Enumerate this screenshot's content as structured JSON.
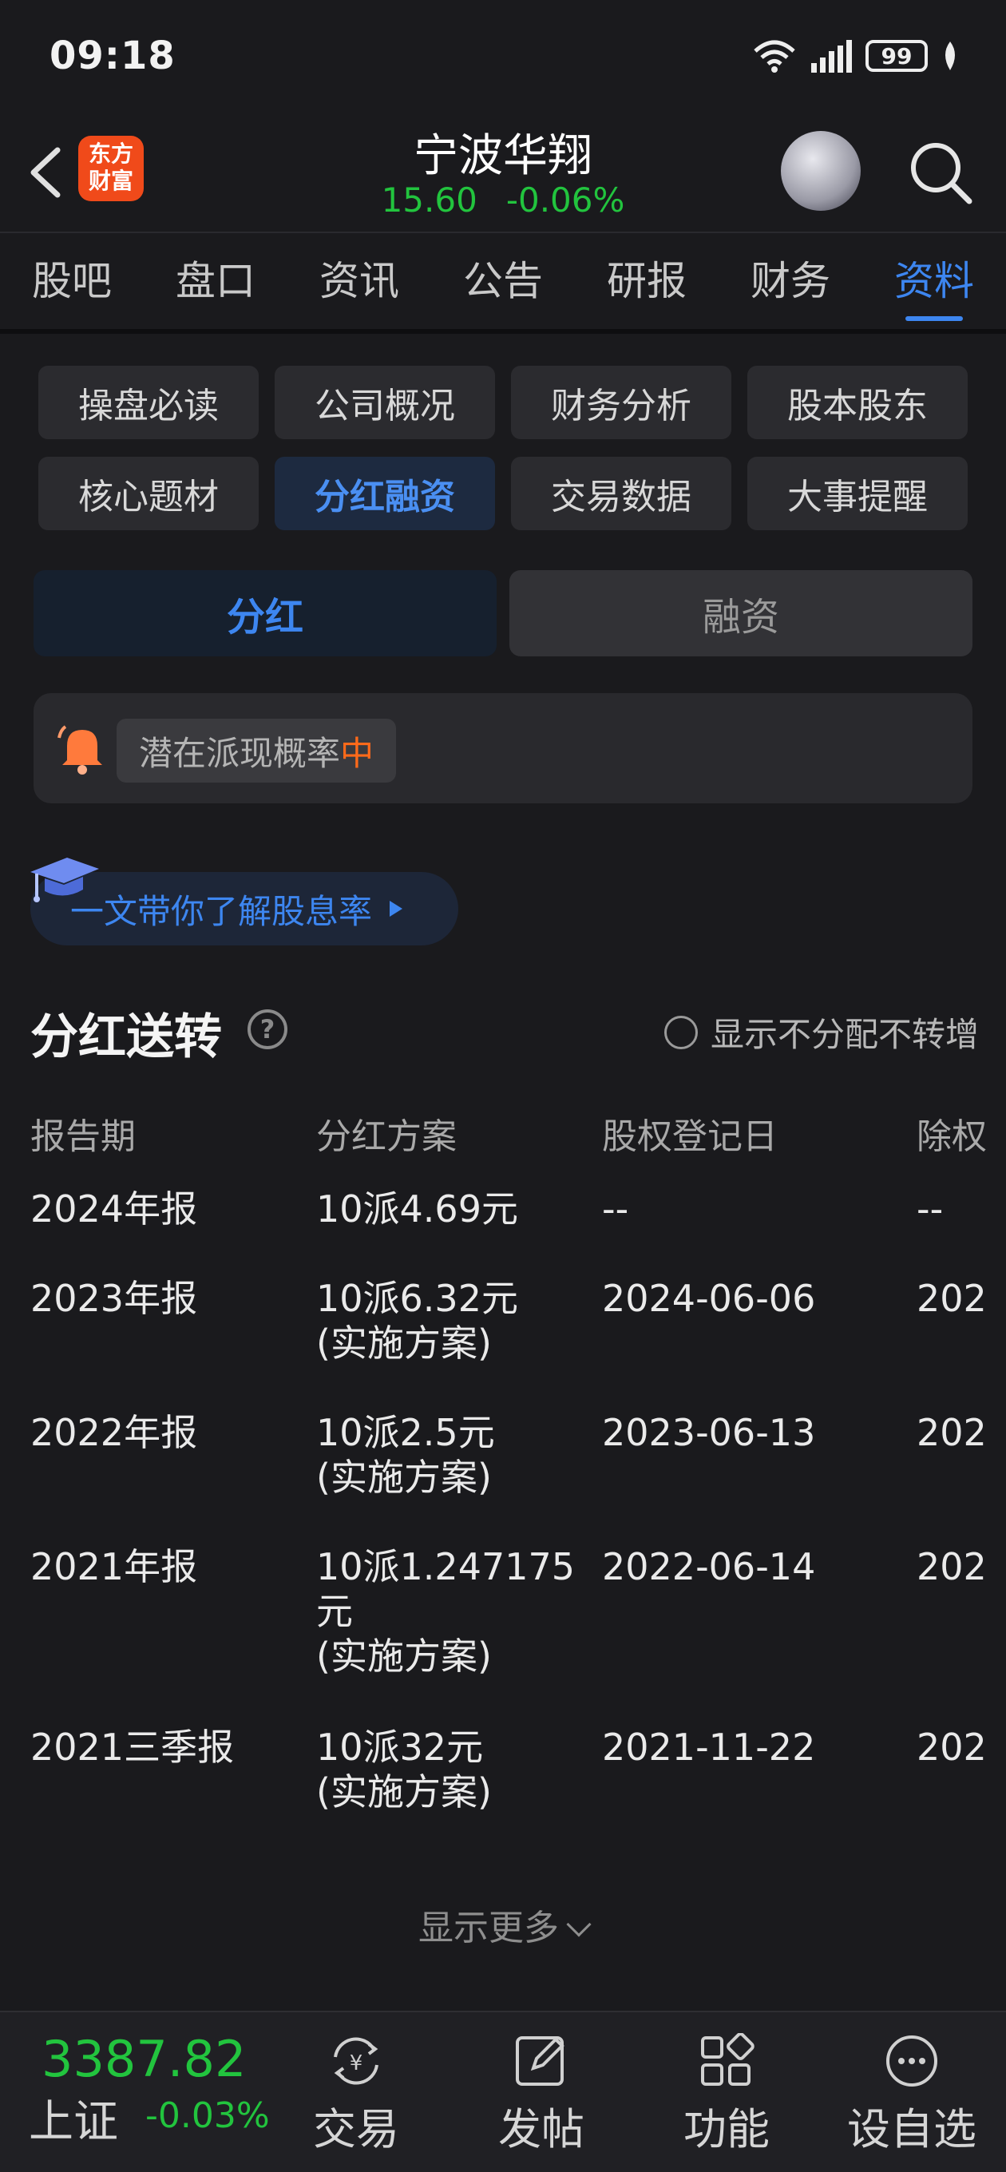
{
  "status": {
    "time": "09:18",
    "battery": "99"
  },
  "header": {
    "logo_line1": "东方",
    "logo_line2": "财富",
    "stock_name": "宁波华翔",
    "price": "15.60",
    "change": "-0.06%"
  },
  "tabs": [
    "股吧",
    "盘口",
    "资讯",
    "公告",
    "研报",
    "财务",
    "资料"
  ],
  "active_tab": "资料",
  "chips": [
    "操盘必读",
    "公司概况",
    "财务分析",
    "股本股东",
    "核心题材",
    "分红融资",
    "交易数据",
    "大事提醒"
  ],
  "active_chip": "分红融资",
  "segments": {
    "dividend": "分红",
    "financing": "融资"
  },
  "alert": {
    "label": "潜在派现概率",
    "level": "中"
  },
  "promo": {
    "text": "一文带你了解股息率"
  },
  "section": {
    "title": "分红送转",
    "help": "?",
    "toggle_label": "显示不分配不转增"
  },
  "table": {
    "headers": [
      "报告期",
      "分红方案",
      "股权登记日",
      "除权"
    ],
    "rows": [
      {
        "period": "2024年报",
        "plan": "10派4.69元",
        "plan_note": "",
        "record_date": "--",
        "ex_date": "--"
      },
      {
        "period": "2023年报",
        "plan": "10派6.32元",
        "plan_note": "(实施方案)",
        "record_date": "2024-06-06",
        "ex_date": "202"
      },
      {
        "period": "2022年报",
        "plan": "10派2.5元",
        "plan_note": "(实施方案)",
        "record_date": "2023-06-13",
        "ex_date": "202"
      },
      {
        "period": "2021年报",
        "plan": "10派1.247175 元",
        "plan_note": "(实施方案)",
        "record_date": "2022-06-14",
        "ex_date": "202"
      },
      {
        "period": "2021三季报",
        "plan": "10派32元",
        "plan_note": "(实施方案)",
        "record_date": "2021-11-22",
        "ex_date": "202"
      }
    ],
    "show_more": "显示更多"
  },
  "bottom": {
    "index_value": "3387.82",
    "index_name": "上证",
    "index_change": "-0.03%",
    "nav": [
      "交易",
      "发帖",
      "功能",
      "设自选"
    ]
  },
  "colors": {
    "up_green": "#22c43e",
    "accent_blue": "#3d86f0",
    "warn_orange": "#ff6a1a"
  }
}
